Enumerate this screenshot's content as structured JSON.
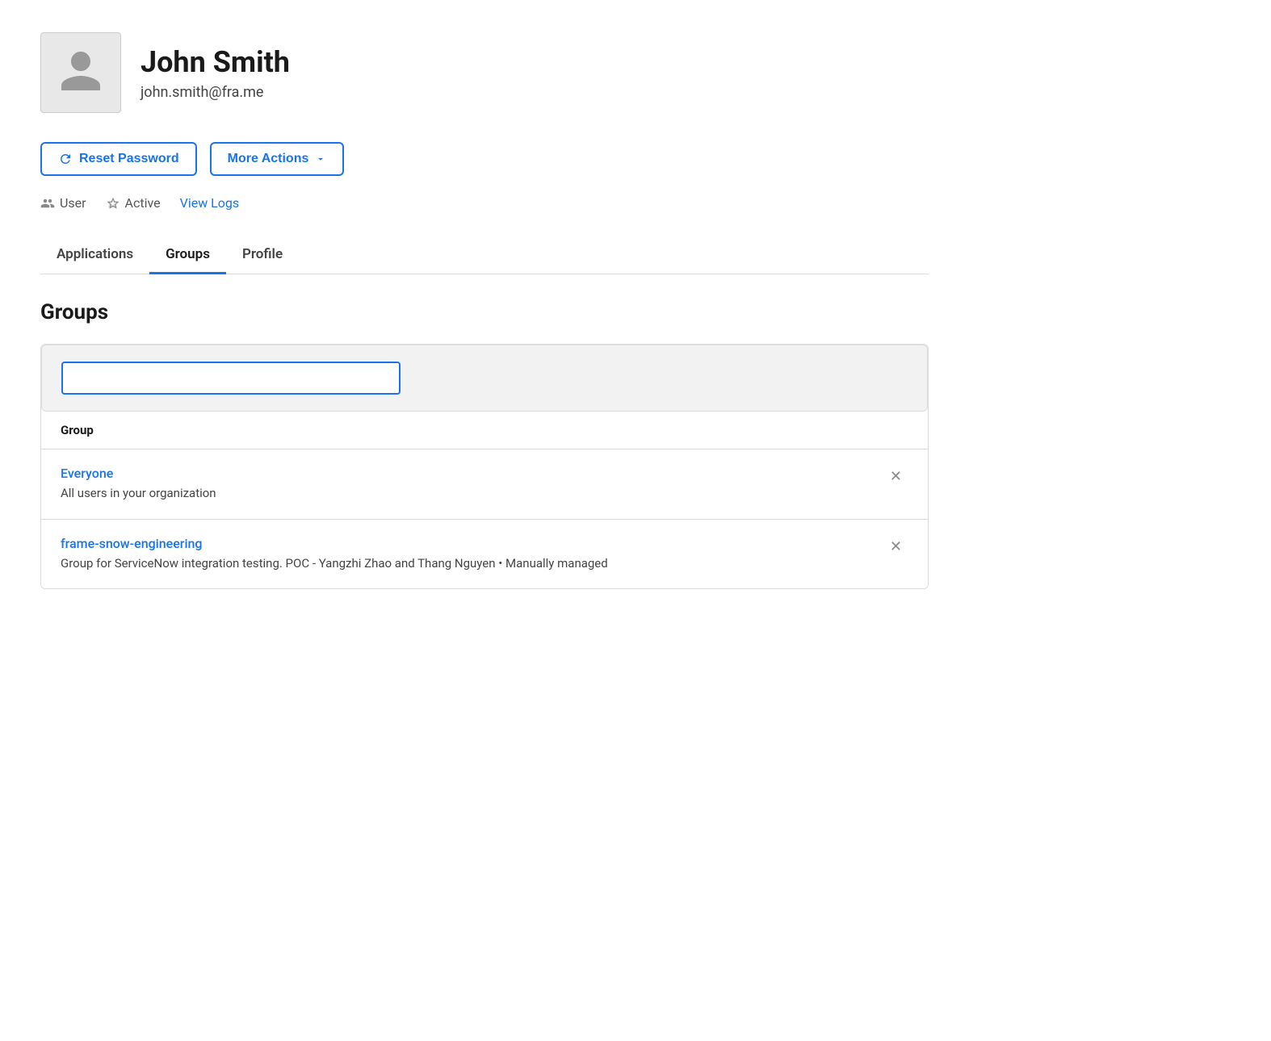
{
  "user": {
    "name": "John Smith",
    "email": "john.smith@fra.me",
    "role": "User",
    "status": "Active"
  },
  "buttons": {
    "reset_password": "Reset Password",
    "more_actions": "More Actions"
  },
  "links": {
    "view_logs": "View Logs"
  },
  "tabs": [
    {
      "id": "applications",
      "label": "Applications",
      "active": false
    },
    {
      "id": "groups",
      "label": "Groups",
      "active": true
    },
    {
      "id": "profile",
      "label": "Profile",
      "active": false
    }
  ],
  "groups_section": {
    "title": "Groups",
    "search_placeholder": "",
    "table_header": "Group",
    "groups": [
      {
        "id": "everyone",
        "name": "Everyone",
        "description": "All users in your organization"
      },
      {
        "id": "frame-snow-engineering",
        "name": "frame-snow-engineering",
        "description": "Group for ServiceNow integration testing. POC - Yangzhi Zhao and Thang Nguyen • Manually managed"
      }
    ]
  },
  "colors": {
    "accent_blue": "#1a73e8",
    "text_dark": "#1a1a1a",
    "text_muted": "#555",
    "border": "#ddd",
    "bg_light": "#f2f2f2"
  }
}
